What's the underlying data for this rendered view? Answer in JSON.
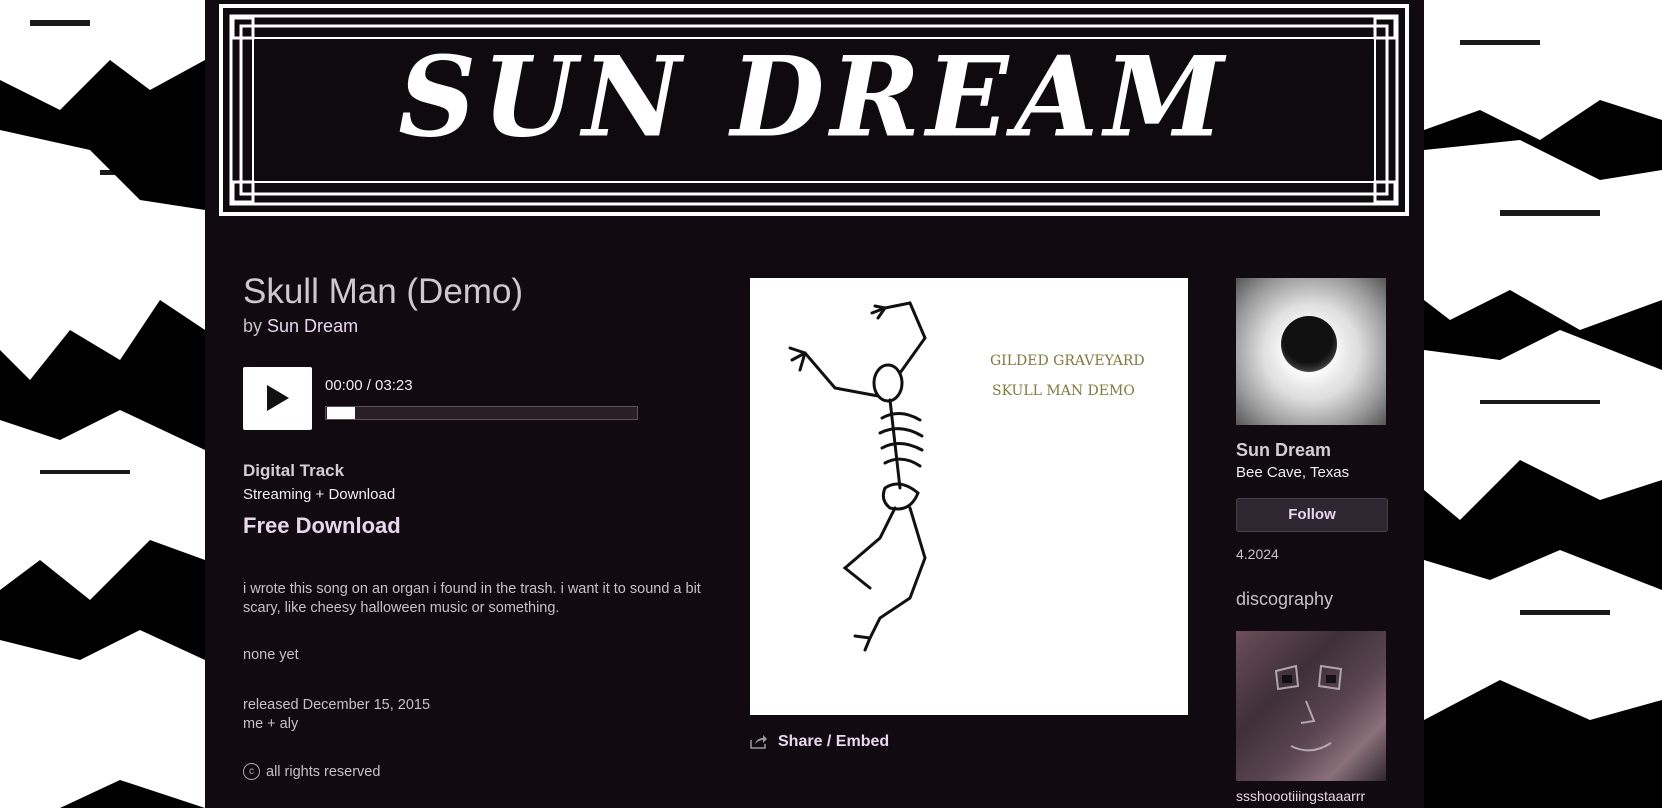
{
  "band": {
    "logo_text": "SUN DREAM",
    "name": "Sun Dream",
    "location": "Bee Cave, Texas",
    "follow_label": "Follow",
    "date": "4.2024"
  },
  "track": {
    "title": "Skull Man (Demo)",
    "by_prefix": "by",
    "artist": "Sun Dream",
    "time": "00:00 / 03:23",
    "progress": 0.0,
    "format": "Digital Track",
    "format_sub": "Streaming + Download",
    "free_download": "Free Download",
    "about": "i wrote this song on an organ i found in the trash. i want it to sound a bit scary, like cheesy halloween music or something.",
    "lyrics": "none yet",
    "released": "released December 15, 2015",
    "credits": "me + aly",
    "rights": "all rights reserved",
    "copyright_symbol": "c"
  },
  "art": {
    "line1": "GILDED GRAVEYARD",
    "line2": "SKULL MAN DEMO"
  },
  "share": {
    "label": "Share / Embed"
  },
  "discography": {
    "heading": "discography",
    "items": [
      {
        "title": "ssshoootiiingstaaarrr"
      }
    ]
  },
  "colors": {
    "page_bg": "#110a10",
    "link": "#e8d6ee",
    "text": "#c8c0c8",
    "art_text": "#7f7a3e"
  }
}
